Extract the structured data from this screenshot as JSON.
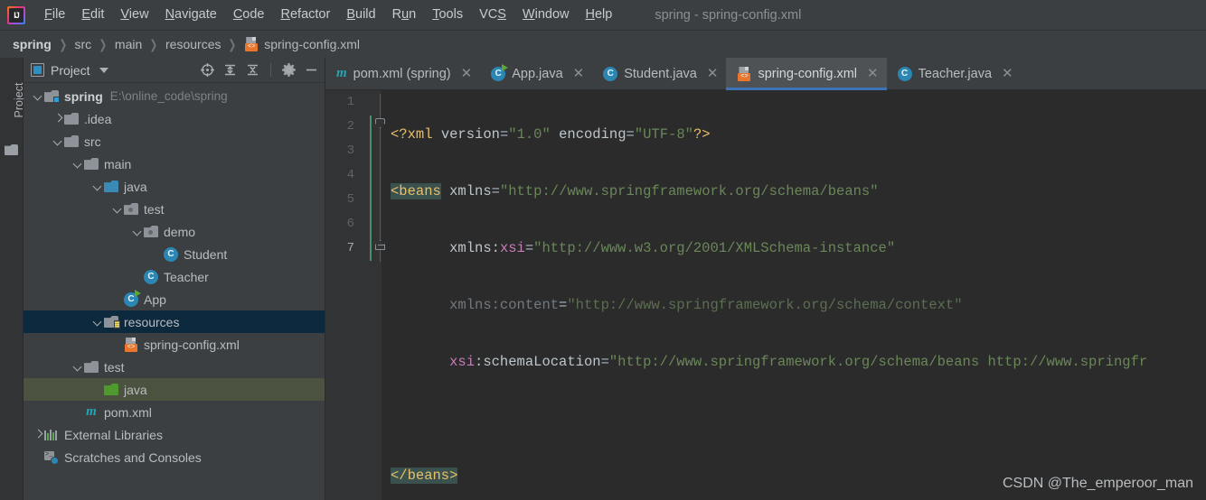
{
  "window": {
    "title": "spring - spring-config.xml"
  },
  "menubar": {
    "logo_icon": "intellij-idea-logo",
    "items": [
      {
        "label": "File",
        "mnemonic": "F"
      },
      {
        "label": "Edit",
        "mnemonic": "E"
      },
      {
        "label": "View",
        "mnemonic": "V"
      },
      {
        "label": "Navigate",
        "mnemonic": "N"
      },
      {
        "label": "Code",
        "mnemonic": "C"
      },
      {
        "label": "Refactor",
        "mnemonic": "R"
      },
      {
        "label": "Build",
        "mnemonic": "B"
      },
      {
        "label": "Run",
        "mnemonic": "u"
      },
      {
        "label": "Tools",
        "mnemonic": "T"
      },
      {
        "label": "VCS",
        "mnemonic": "S"
      },
      {
        "label": "Window",
        "mnemonic": "W"
      },
      {
        "label": "Help",
        "mnemonic": "H"
      }
    ]
  },
  "breadcrumb": {
    "separator": "❯",
    "items": [
      "spring",
      "src",
      "main",
      "resources"
    ],
    "file": "spring-config.xml",
    "file_icon": "xml-file-icon"
  },
  "toolstrip": {
    "label": "Project",
    "icon": "folder-icon"
  },
  "project_panel": {
    "title": "Project",
    "title_icon": "project-view-icon",
    "dropdown_icon": "chevron-down-icon",
    "tools": [
      {
        "name": "select-opened-file-icon",
        "tooltip": "Select Opened File"
      },
      {
        "name": "expand-all-icon",
        "tooltip": "Expand All"
      },
      {
        "name": "collapse-all-icon",
        "tooltip": "Collapse All"
      },
      {
        "name": "gear-icon",
        "tooltip": "Options"
      },
      {
        "name": "minimize-icon",
        "tooltip": "Hide"
      }
    ],
    "tree": [
      {
        "label": "spring",
        "subpath": "E:\\online_code\\spring",
        "icon": "module-folder-icon",
        "arrow": "down",
        "indent": 0,
        "bold": true,
        "state": "normal"
      },
      {
        "label": ".idea",
        "subpath": "",
        "icon": "folder-icon",
        "arrow": "right",
        "indent": 1,
        "bold": false,
        "state": "normal"
      },
      {
        "label": "src",
        "subpath": "",
        "icon": "folder-icon",
        "arrow": "down",
        "indent": 1,
        "bold": false,
        "state": "normal"
      },
      {
        "label": "main",
        "subpath": "",
        "icon": "folder-icon",
        "arrow": "down",
        "indent": 2,
        "bold": false,
        "state": "normal"
      },
      {
        "label": "java",
        "subpath": "",
        "icon": "source-folder-icon",
        "arrow": "down",
        "indent": 3,
        "bold": false,
        "state": "normal"
      },
      {
        "label": "test",
        "subpath": "",
        "icon": "package-folder-icon",
        "arrow": "down",
        "indent": 4,
        "bold": false,
        "state": "normal"
      },
      {
        "label": "demo",
        "subpath": "",
        "icon": "package-folder-icon",
        "arrow": "down",
        "indent": 5,
        "bold": false,
        "state": "normal"
      },
      {
        "label": "Student",
        "subpath": "",
        "icon": "java-class-icon",
        "arrow": "none",
        "indent": 6,
        "bold": false,
        "state": "normal"
      },
      {
        "label": "Teacher",
        "subpath": "",
        "icon": "java-class-icon",
        "arrow": "none",
        "indent": 5,
        "bold": false,
        "state": "normal"
      },
      {
        "label": "App",
        "subpath": "",
        "icon": "java-runnable-class-icon",
        "arrow": "none",
        "indent": 4,
        "bold": false,
        "state": "normal"
      },
      {
        "label": "resources",
        "subpath": "",
        "icon": "resources-folder-icon",
        "arrow": "down",
        "indent": 3,
        "bold": false,
        "state": "selected"
      },
      {
        "label": "spring-config.xml",
        "subpath": "",
        "icon": "xml-file-icon",
        "arrow": "none",
        "indent": 4,
        "bold": false,
        "state": "normal"
      },
      {
        "label": "test",
        "subpath": "",
        "icon": "folder-icon",
        "arrow": "down",
        "indent": 2,
        "bold": false,
        "state": "normal"
      },
      {
        "label": "java",
        "subpath": "",
        "icon": "test-source-folder-icon",
        "arrow": "none",
        "indent": 3,
        "bold": false,
        "state": "green-sel"
      },
      {
        "label": "pom.xml",
        "subpath": "",
        "icon": "maven-icon",
        "arrow": "none",
        "indent": 2,
        "bold": false,
        "state": "normal"
      },
      {
        "label": "External Libraries",
        "subpath": "",
        "icon": "external-libraries-icon",
        "arrow": "right",
        "indent": 0,
        "bold": false,
        "state": "normal"
      },
      {
        "label": "Scratches and Consoles",
        "subpath": "",
        "icon": "scratches-icon",
        "arrow": "none",
        "indent": 0,
        "bold": false,
        "state": "normal"
      }
    ]
  },
  "editor": {
    "tabs": [
      {
        "label": "pom.xml (spring)",
        "icon": "maven-icon",
        "active": false,
        "close_icon": "close-icon"
      },
      {
        "label": "App.java",
        "icon": "java-runnable-class-icon",
        "active": false,
        "close_icon": "close-icon"
      },
      {
        "label": "Student.java",
        "icon": "java-class-icon",
        "active": false,
        "close_icon": "close-icon"
      },
      {
        "label": "spring-config.xml",
        "icon": "xml-file-icon",
        "active": true,
        "close_icon": "close-icon"
      },
      {
        "label": "Teacher.java",
        "icon": "java-class-icon",
        "active": false,
        "close_icon": "close-icon"
      }
    ],
    "line_numbers": [
      "1",
      "2",
      "3",
      "4",
      "5",
      "6",
      "7"
    ],
    "caret_line": 7,
    "code_lines": [
      "<?xml version=\"1.0\" encoding=\"UTF-8\"?>",
      "<beans xmlns=\"http://www.springframework.org/schema/beans\"",
      "       xmlns:xsi=\"http://www.w3.org/2001/XMLSchema-instance\"",
      "       xmlns:content=\"http://www.springframework.org/schema/context\"",
      "       xsi:schemaLocation=\"http://www.springframework.org/schema/beans http://www.springfr",
      "",
      "</beans>"
    ]
  },
  "watermark": {
    "text": "CSDN @The_emperoor_man"
  },
  "colors": {
    "window_bg": "#3c3f41",
    "editor_bg": "#2b2b2b",
    "gutter_bg": "#313335",
    "tab_active_bg": "#4e5254",
    "tab_underline": "#3c73b8",
    "tree_selection": "#0d293e",
    "tree_green_selection": "#4b5340",
    "xml_tag": "#e8bf6a",
    "xml_attr": "#bcc6cc",
    "xml_string": "#6a8759",
    "xml_namespace": "#c77dbb",
    "match_highlight": "#3b514d",
    "xml_icon_accent": "#e8762c"
  }
}
